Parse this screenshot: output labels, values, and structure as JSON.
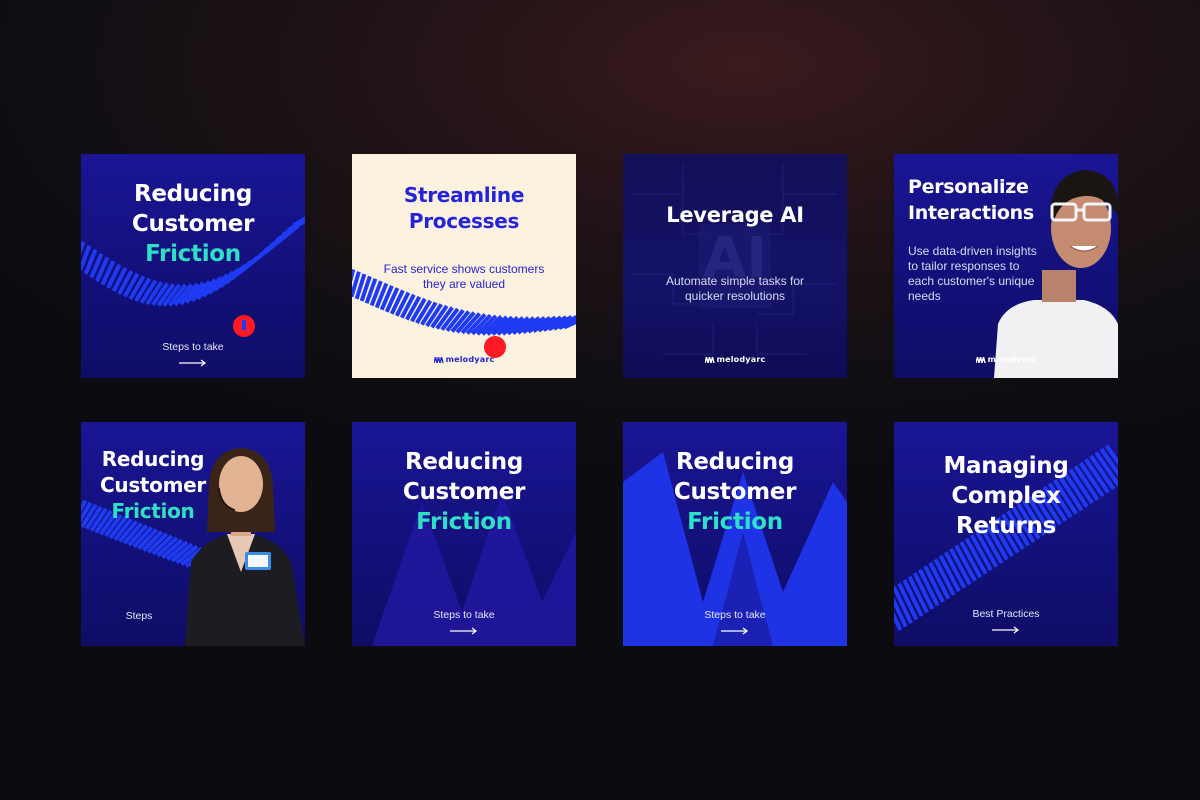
{
  "cards": [
    {
      "title_line1": "Reducing",
      "title_line2": "Customer",
      "title_line3": "Friction",
      "cta": "Steps to take"
    },
    {
      "title_line1": "Streamline",
      "title_line2": "Processes",
      "subtitle_line1": "Fast service shows customers",
      "subtitle_line2": "they are valued",
      "brand": "melodyarc"
    },
    {
      "title": "Leverage AI",
      "bg_text": "AI",
      "subtitle_line1": "Automate simple tasks for",
      "subtitle_line2": "quicker resolutions",
      "brand": "melodyarc"
    },
    {
      "title_line1": "Personalize",
      "title_line2": "Interactions",
      "subtitle_line1": "Use data-driven insights",
      "subtitle_line2": "to tailor responses to",
      "subtitle_line3": "each customer's unique",
      "subtitle_line4": "needs",
      "brand": "melodyarc"
    },
    {
      "title_line1": "Reducing",
      "title_line2": "Customer",
      "title_line3": "Friction",
      "cta": "Steps"
    },
    {
      "title_line1": "Reducing",
      "title_line2": "Customer",
      "title_line3": "Friction",
      "cta": "Steps to take"
    },
    {
      "title_line1": "Reducing",
      "title_line2": "Customer",
      "title_line3": "Friction",
      "cta": "Steps to take"
    },
    {
      "title_line1": "Managing",
      "title_line2": "Complex",
      "title_line3": "Returns",
      "cta": "Best Practices"
    }
  ],
  "colors": {
    "card_blue": "#16127a",
    "accent": "#2ee0c6",
    "cream": "#fdf1df",
    "domino": "#1f3bf2",
    "dot": "#ff1a24"
  }
}
